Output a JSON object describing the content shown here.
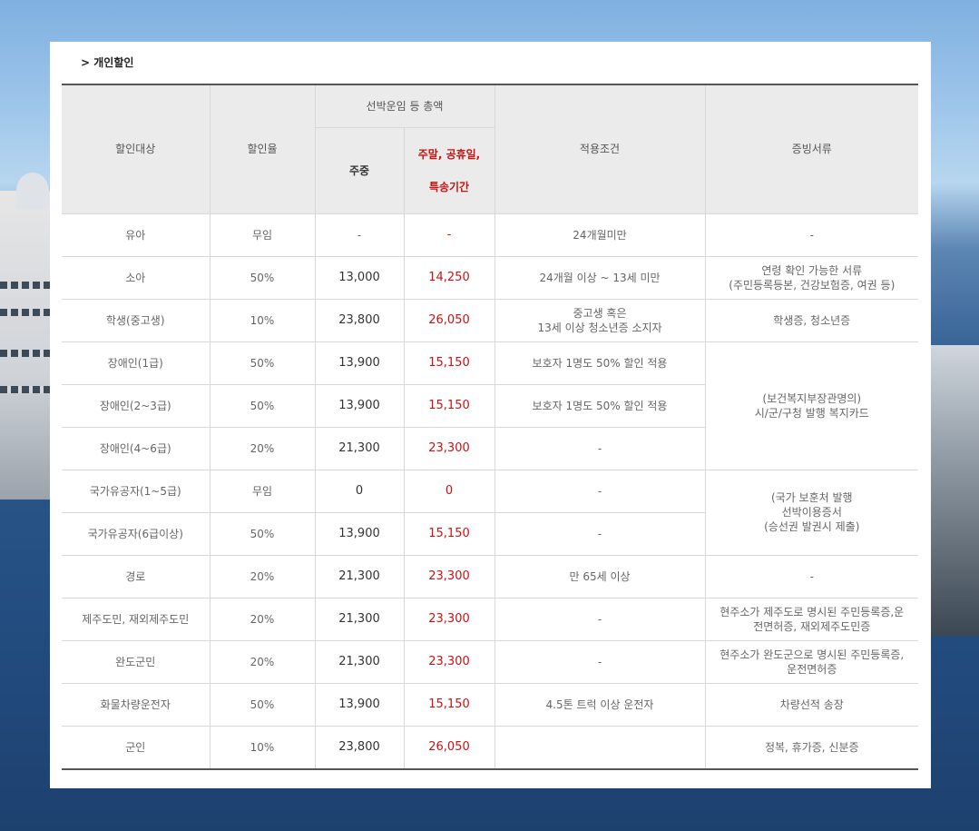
{
  "section_title": "> 개인할인",
  "headers": {
    "target": "할인대상",
    "rate": "할인율",
    "total_group": "선박운임 등 총액",
    "weekday": "주중",
    "weekend_line1": "주말, 공휴일,",
    "weekend_line2": "특송기간",
    "condition": "적용조건",
    "documents": "증빙서류"
  },
  "rows": [
    {
      "target": "유아",
      "rate": "무임",
      "weekday": "-",
      "weekend": "-",
      "condition": "24개월미만",
      "documents": "-"
    },
    {
      "target": "소아",
      "rate": "50%",
      "weekday": "13,000",
      "weekend": "14,250",
      "condition": "24개월 이상 ~ 13세 미만",
      "documents_line1": "연령 확인 가능한 서류",
      "documents_line2": "(주민등록등본, 건강보험증, 여권 등)"
    },
    {
      "target": "학생(중고생)",
      "rate": "10%",
      "weekday": "23,800",
      "weekend": "26,050",
      "condition_line1": "중고생 혹은",
      "condition_line2": "13세 이상 청소년증 소지자",
      "documents": "학생증, 청소년증"
    },
    {
      "target": "장애인(1급)",
      "rate": "50%",
      "weekday": "13,900",
      "weekend": "15,150",
      "condition": "보호자 1명도 50% 할인 적용"
    },
    {
      "target": "장애인(2~3급)",
      "rate": "50%",
      "weekday": "13,900",
      "weekend": "15,150",
      "condition": "보호자 1명도 50% 할인 적용"
    },
    {
      "target": "장애인(4~6급)",
      "rate": "20%",
      "weekday": "21,300",
      "weekend": "23,300",
      "condition": "-"
    },
    {
      "target": "국가유공자(1~5급)",
      "rate": "무임",
      "weekday": "0",
      "weekend": "0",
      "condition": "-"
    },
    {
      "target": "국가유공자(6급이상)",
      "rate": "50%",
      "weekday": "13,900",
      "weekend": "15,150",
      "condition": "-"
    },
    {
      "target": "경로",
      "rate": "20%",
      "weekday": "21,300",
      "weekend": "23,300",
      "condition": "만 65세 이상",
      "documents": "-"
    },
    {
      "target": "제주도민, 재외제주도민",
      "rate": "20%",
      "weekday": "21,300",
      "weekend": "23,300",
      "condition": "-",
      "documents_line1": "현주소가 제주도로 명시된 주민등록증,운",
      "documents_line2": "전면허증, 재외제주도민증"
    },
    {
      "target": "완도군민",
      "rate": "20%",
      "weekday": "21,300",
      "weekend": "23,300",
      "condition": "-",
      "documents_line1": "현주소가 완도군으로 명시된 주민등록증,",
      "documents_line2": "운전면허증"
    },
    {
      "target": "화물차량운전자",
      "rate": "50%",
      "weekday": "13,900",
      "weekend": "15,150",
      "condition": "4.5톤 트럭 이상 운전자",
      "documents": "차량선적 송장"
    },
    {
      "target": "군인",
      "rate": "10%",
      "weekday": "23,800",
      "weekend": "26,050",
      "condition": "",
      "documents": "정복, 휴가증, 신분증"
    }
  ],
  "merged_docs": {
    "disabled_line1": "(보건복지부장관명의)",
    "disabled_line2": "시/군/구청 발행 복지카드",
    "merit_line1": "(국가 보훈처 발행",
    "merit_line2": "선박이용증서",
    "merit_line3": "(승선권 발권시 제출)"
  },
  "colors": {
    "accent_red": "#cc1111",
    "header_bg": "#ebebeb"
  }
}
